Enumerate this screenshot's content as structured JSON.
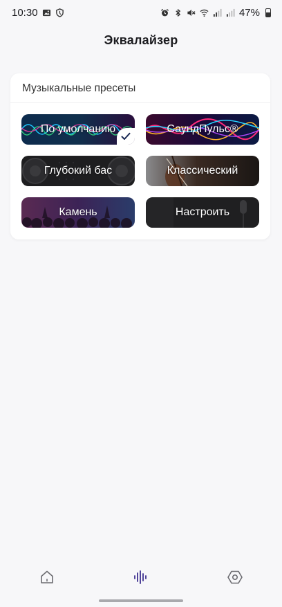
{
  "status_bar": {
    "time": "10:30",
    "battery": "47%",
    "left_icons": [
      "image-icon",
      "shield-icon"
    ],
    "right_icons": [
      "alarm-icon",
      "bluetooth-icon",
      "mute-icon",
      "wifi-icon",
      "signal-icon",
      "signal-icon",
      "battery-icon"
    ]
  },
  "header": {
    "title": "Эквалайзер"
  },
  "presets_card": {
    "title": "Музыкальные пресеты",
    "items": [
      {
        "label": "По умолчанию",
        "selected": true
      },
      {
        "label": "СаундПульс®",
        "selected": false
      },
      {
        "label": "Глубокий бас",
        "selected": false
      },
      {
        "label": "Классический",
        "selected": false
      },
      {
        "label": "Камень",
        "selected": false
      },
      {
        "label": "Настроить",
        "selected": false
      }
    ]
  },
  "bottom_nav": {
    "items": [
      {
        "icon": "home-icon",
        "active": false
      },
      {
        "icon": "equalizer-icon",
        "active": true
      },
      {
        "icon": "settings-hexagon-icon",
        "active": false
      }
    ],
    "active_color": "#3d2f8f",
    "inactive_color": "#6b6b70"
  }
}
